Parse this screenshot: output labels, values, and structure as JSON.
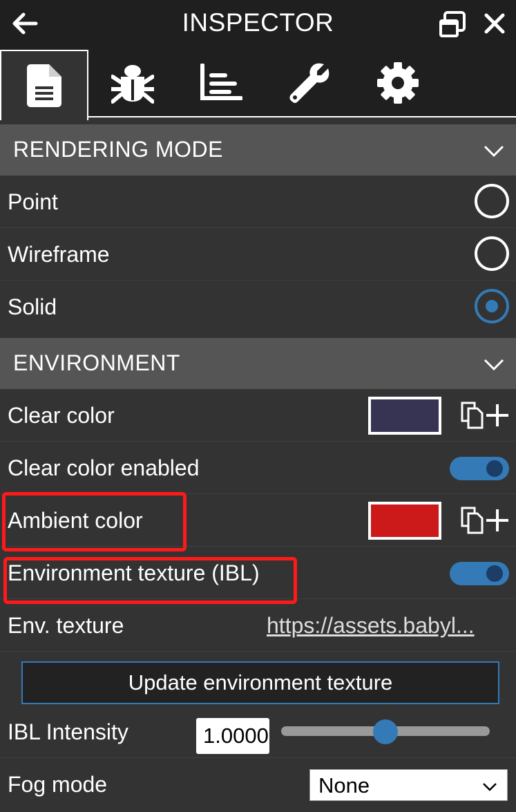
{
  "header": {
    "title": "INSPECTOR"
  },
  "tabs": [
    {
      "name": "document-icon",
      "active": true
    },
    {
      "name": "bug-icon",
      "active": false
    },
    {
      "name": "chart-icon",
      "active": false
    },
    {
      "name": "wrench-icon",
      "active": false
    },
    {
      "name": "gear-icon",
      "active": false
    }
  ],
  "rendering_mode": {
    "title": "RENDERING MODE",
    "options": [
      {
        "label": "Point",
        "checked": false
      },
      {
        "label": "Wireframe",
        "checked": false
      },
      {
        "label": "Solid",
        "checked": true
      }
    ]
  },
  "environment": {
    "title": "ENVIRONMENT",
    "clear_color": {
      "label": "Clear color",
      "color": "#363452"
    },
    "clear_color_enabled": {
      "label": "Clear color enabled",
      "on": true
    },
    "ambient_color": {
      "label": "Ambient color",
      "color": "#cc1a1a"
    },
    "env_texture_ibl": {
      "label": "Environment texture (IBL)",
      "on": true
    },
    "env_texture": {
      "label": "Env. texture",
      "value": "https://assets.babyl..."
    },
    "update_button": "Update environment texture",
    "ibl_intensity": {
      "label": "IBL Intensity",
      "value": "1.0000",
      "slider_fraction": 0.5
    },
    "fog_mode": {
      "label": "Fog mode",
      "selected": "None"
    }
  },
  "colors": {
    "accent": "#337ab7",
    "annotation": "#ff1a1a",
    "section_bg": "#555555",
    "panel_bg": "#333333"
  }
}
